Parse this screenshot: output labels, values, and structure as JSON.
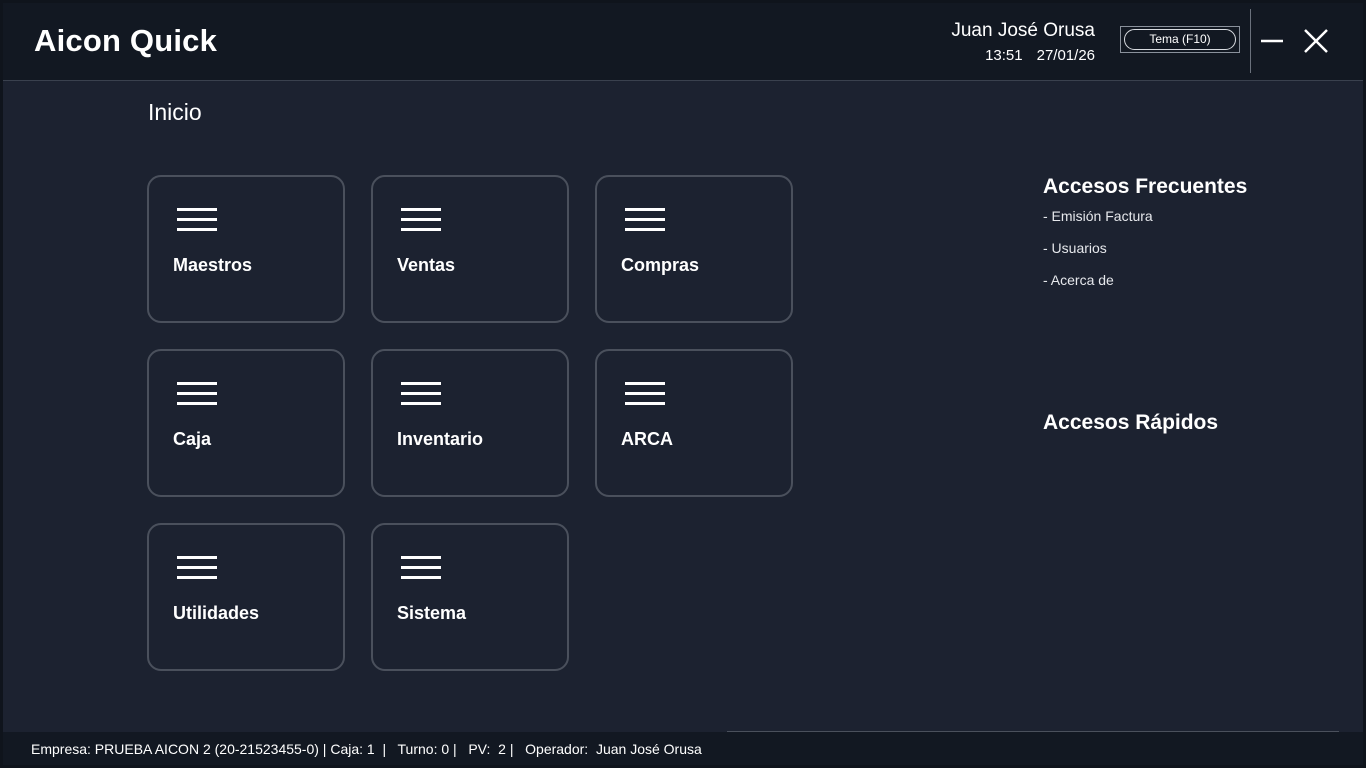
{
  "header": {
    "app_title": "Aicon Quick",
    "user_name": "Juan José Orusa",
    "time": "13:51",
    "date": "27/01/26",
    "theme_button_label": "Tema (F10)"
  },
  "main": {
    "title": "Inicio",
    "tiles": [
      {
        "label": "Maestros",
        "icon": "menu-icon"
      },
      {
        "label": "Ventas",
        "icon": "menu-icon"
      },
      {
        "label": "Compras",
        "icon": "menu-icon"
      },
      {
        "label": "Caja",
        "icon": "menu-icon"
      },
      {
        "label": "Inventario",
        "icon": "menu-icon"
      },
      {
        "label": "ARCA",
        "icon": "menu-icon"
      },
      {
        "label": "Utilidades",
        "icon": "menu-icon"
      },
      {
        "label": "Sistema",
        "icon": "menu-icon"
      }
    ]
  },
  "side": {
    "frequent_title": "Accesos Frecuentes",
    "frequent_items": [
      "- Emisión Factura",
      "- Usuarios",
      "- Acerca de"
    ],
    "quick_title": "Accesos Rápidos"
  },
  "status_bar": {
    "text": "Empresa: PRUEBA AICON 2 (20-21523455-0) | Caja: 1  |   Turno: 0 |   PV:  2 |   Operador:  Juan José Orusa"
  },
  "colors": {
    "background": "#1c2230",
    "header_background": "#121822",
    "tile_border": "#4a505c",
    "text": "#ffffff"
  }
}
